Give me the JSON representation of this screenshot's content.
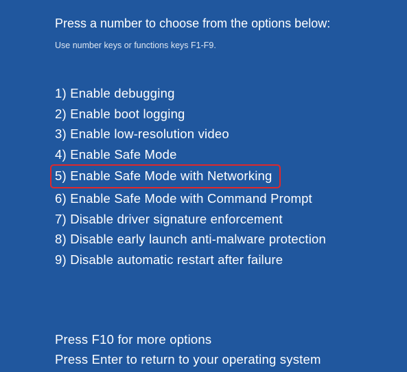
{
  "title": "Press a number to choose from the options below:",
  "subtitle": "Use number keys or functions keys F1-F9.",
  "options": [
    {
      "label": "1) Enable debugging",
      "highlighted": false
    },
    {
      "label": "2) Enable boot logging",
      "highlighted": false
    },
    {
      "label": "3) Enable low-resolution video",
      "highlighted": false
    },
    {
      "label": "4) Enable Safe Mode",
      "highlighted": false
    },
    {
      "label": "5) Enable Safe Mode with Networking",
      "highlighted": true
    },
    {
      "label": "6) Enable Safe Mode with Command Prompt",
      "highlighted": false
    },
    {
      "label": "7) Disable driver signature enforcement",
      "highlighted": false
    },
    {
      "label": "8) Disable early launch anti-malware protection",
      "highlighted": false
    },
    {
      "label": "9) Disable automatic restart after failure",
      "highlighted": false
    }
  ],
  "footer": {
    "line1": "Press F10 for more options",
    "line2": "Press Enter to return to your operating system"
  },
  "highlight_color": "#e0282b",
  "background_color": "#20579e"
}
